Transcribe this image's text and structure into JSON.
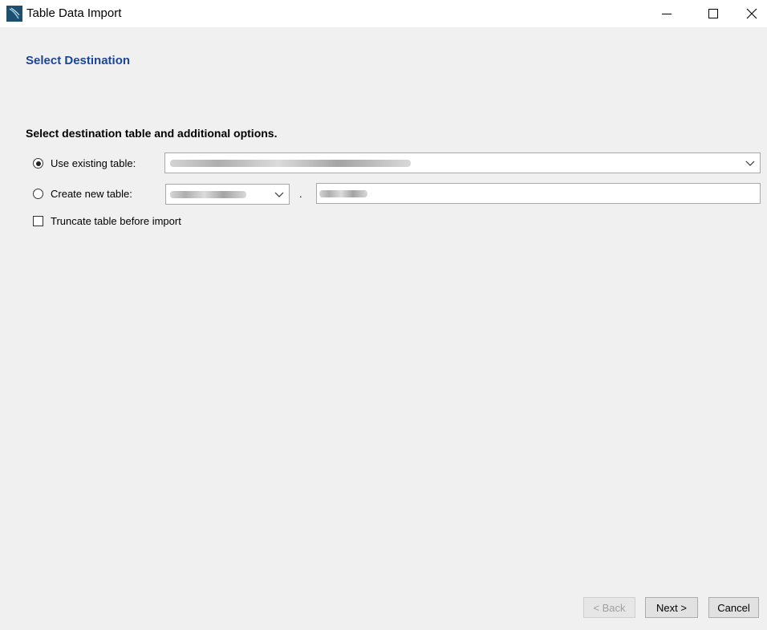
{
  "window": {
    "title": "Table Data Import",
    "controls": [
      "minimize",
      "maximize",
      "close"
    ],
    "icon": "mysql-workbench-icon"
  },
  "page": {
    "heading": "Select Destination",
    "subheading": "Select destination table and additional options.",
    "use_existing": {
      "label": "Use existing table:",
      "checked": true,
      "value": ""
    },
    "create_new": {
      "label": "Create new table:",
      "checked": false,
      "schema_value": "",
      "separator": ".",
      "table_value": ""
    },
    "truncate": {
      "label": "Truncate table before import",
      "checked": false
    }
  },
  "footer": {
    "back_label": "< Back",
    "next_label": "Next >",
    "cancel_label": "Cancel"
  },
  "colors": {
    "heading": "#1c4596",
    "background": "#f0f0f0"
  }
}
